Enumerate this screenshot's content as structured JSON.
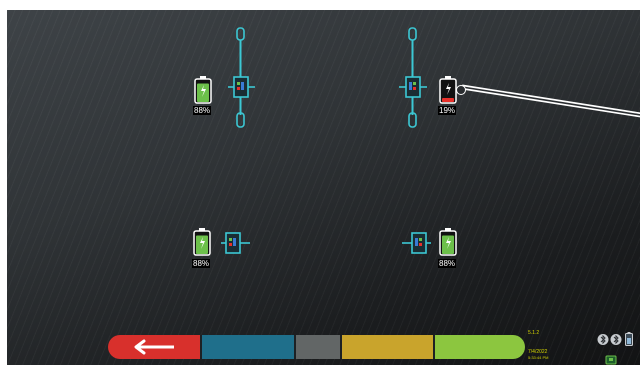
{
  "batteries": {
    "front_left": {
      "percent": "88%",
      "level": 0.88,
      "status_color": "#6cc04a"
    },
    "front_right": {
      "percent": "19%",
      "level": 0.19,
      "status_color": "#e8302a"
    },
    "rear_left": {
      "percent": "88%",
      "level": 0.88,
      "status_color": "#6cc04a"
    },
    "rear_right": {
      "percent": "88%",
      "level": 0.88,
      "status_color": "#6cc04a"
    }
  },
  "sensor_color": "#3cc8d4",
  "bottom_bar": {
    "segments": [
      {
        "name": "back",
        "color": "#d8302c",
        "icon": "arrow-left-icon"
      },
      {
        "name": "blue",
        "color": "#1f6f8b"
      },
      {
        "name": "grey",
        "color": "#626666"
      },
      {
        "name": "yellow",
        "color": "#c9a42c"
      },
      {
        "name": "green",
        "color": "#8cc63f"
      }
    ]
  },
  "info": {
    "version": "5.1.2",
    "date": "7/4/2022",
    "time": "5:33:44 PM",
    "text_color": "#d4d400"
  },
  "status_icons": [
    "bluetooth-icon",
    "bluetooth-icon",
    "battery-icon",
    "network-icon"
  ]
}
